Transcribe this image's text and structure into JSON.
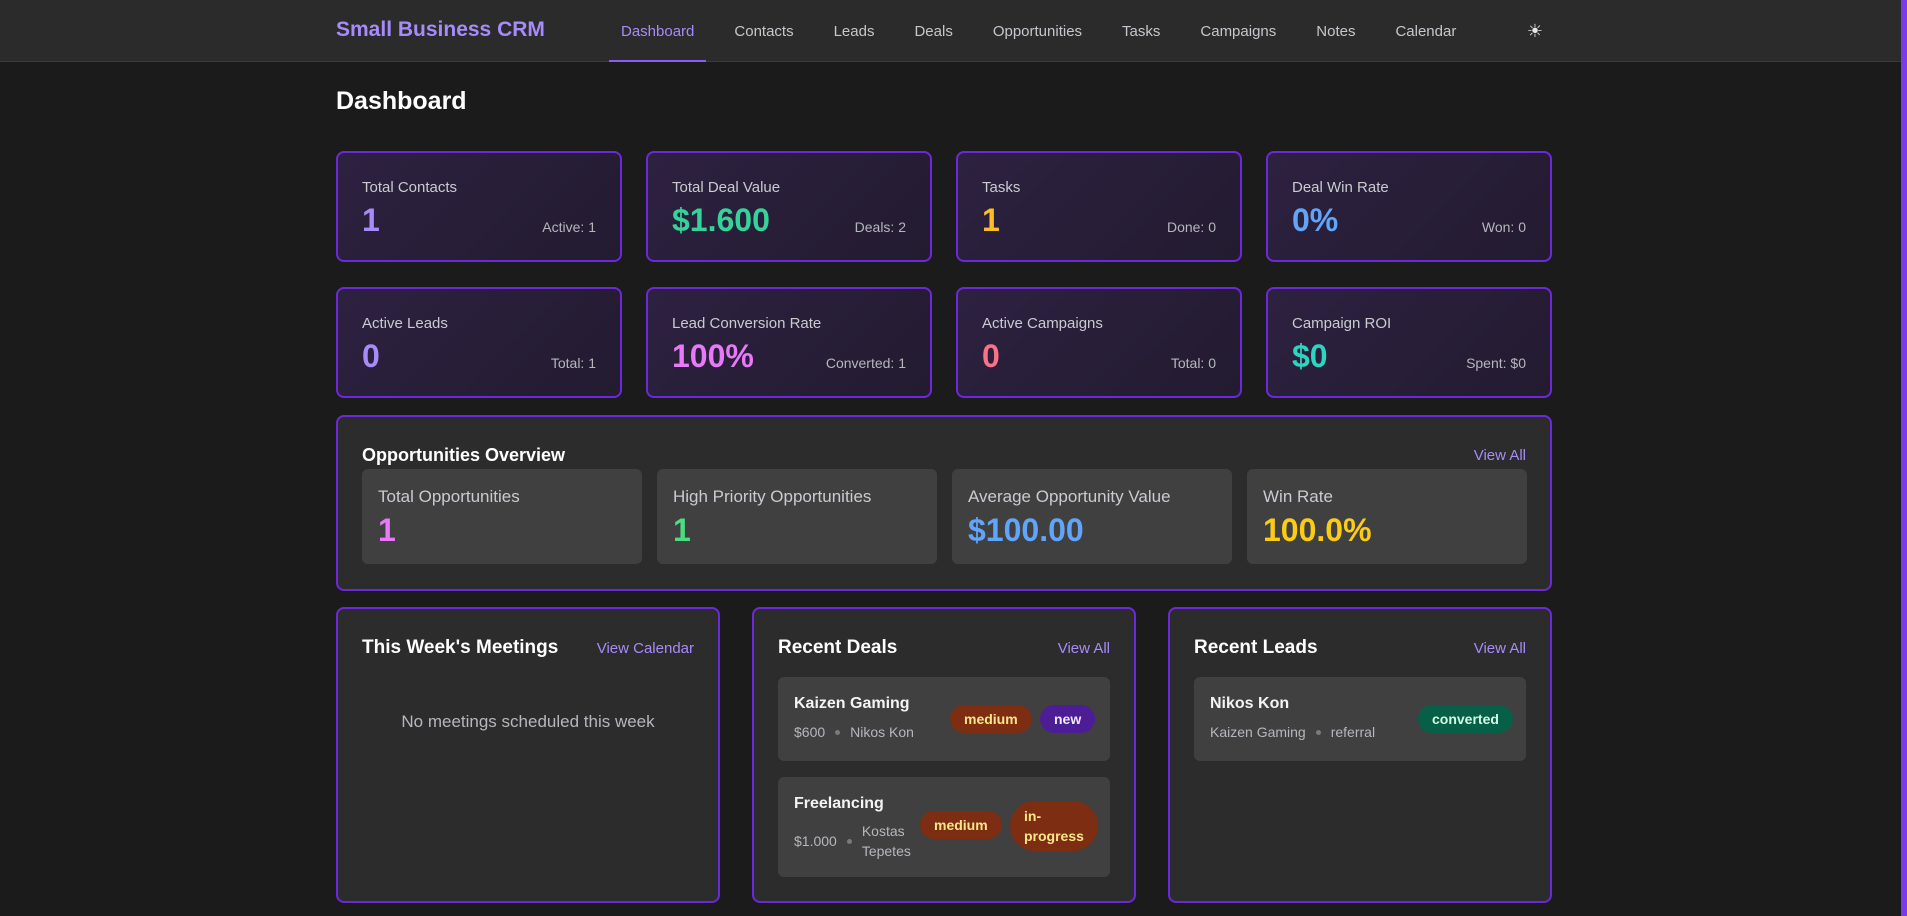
{
  "app": {
    "title": "Small Business CRM",
    "theme_icon": "sun-icon"
  },
  "nav": {
    "items": [
      {
        "label": "Dashboard"
      },
      {
        "label": "Contacts"
      },
      {
        "label": "Leads"
      },
      {
        "label": "Deals"
      },
      {
        "label": "Opportunities"
      },
      {
        "label": "Tasks"
      },
      {
        "label": "Campaigns"
      },
      {
        "label": "Notes"
      },
      {
        "label": "Calendar"
      }
    ],
    "active": "Dashboard"
  },
  "page": {
    "title": "Dashboard"
  },
  "stats": [
    {
      "label": "Total Contacts",
      "value": "1",
      "sub": "Active: 1",
      "color": "#a78bfa"
    },
    {
      "label": "Total Deal Value",
      "value": "$1.600",
      "sub": "Deals: 2",
      "color": "#34d399"
    },
    {
      "label": "Tasks",
      "value": "1",
      "sub": "Done: 0",
      "color": "#fbbf24"
    },
    {
      "label": "Deal Win Rate",
      "value": "0%",
      "sub": "Won: 0",
      "color": "#60a5fa"
    },
    {
      "label": "Active Leads",
      "value": "0",
      "sub": "Total: 1",
      "color": "#a78bfa"
    },
    {
      "label": "Lead Conversion Rate",
      "value": "100%",
      "sub": "Converted: 1",
      "color": "#e879f9"
    },
    {
      "label": "Active Campaigns",
      "value": "0",
      "sub": "Total: 0",
      "color": "#fb7185"
    },
    {
      "label": "Campaign ROI",
      "value": "$0",
      "sub": "Spent: $0",
      "color": "#2dd4bf"
    }
  ],
  "opportunities": {
    "title": "Opportunities Overview",
    "link": "View All",
    "boxes": [
      {
        "label": "Total Opportunities",
        "value": "1",
        "color": "#e879f9"
      },
      {
        "label": "High Priority Opportunities",
        "value": "1",
        "color": "#4ade80"
      },
      {
        "label": "Average Opportunity Value",
        "value": "$100.00",
        "color": "#60a5fa"
      },
      {
        "label": "Win Rate",
        "value": "100.0%",
        "color": "#facc15"
      }
    ]
  },
  "meetings": {
    "title": "This Week's Meetings",
    "link": "View Calendar",
    "empty": "No meetings scheduled this week"
  },
  "recent_deals": {
    "title": "Recent Deals",
    "link": "View All",
    "items": [
      {
        "name": "Kaizen Gaming",
        "amount": "$600",
        "contact": "Nikos Kon",
        "priority": "medium",
        "status": "new"
      },
      {
        "name": "Freelancing",
        "amount": "$1.000",
        "contact_line1": "Kostas",
        "contact_line2": "Tepetes",
        "priority": "medium",
        "status_line1": "in-",
        "status_line2": "progress"
      }
    ]
  },
  "recent_leads": {
    "title": "Recent Leads",
    "link": "View All",
    "items": [
      {
        "name": "Nikos Kon",
        "company": "Kaizen Gaming",
        "source": "referral",
        "status": "converted"
      }
    ]
  }
}
